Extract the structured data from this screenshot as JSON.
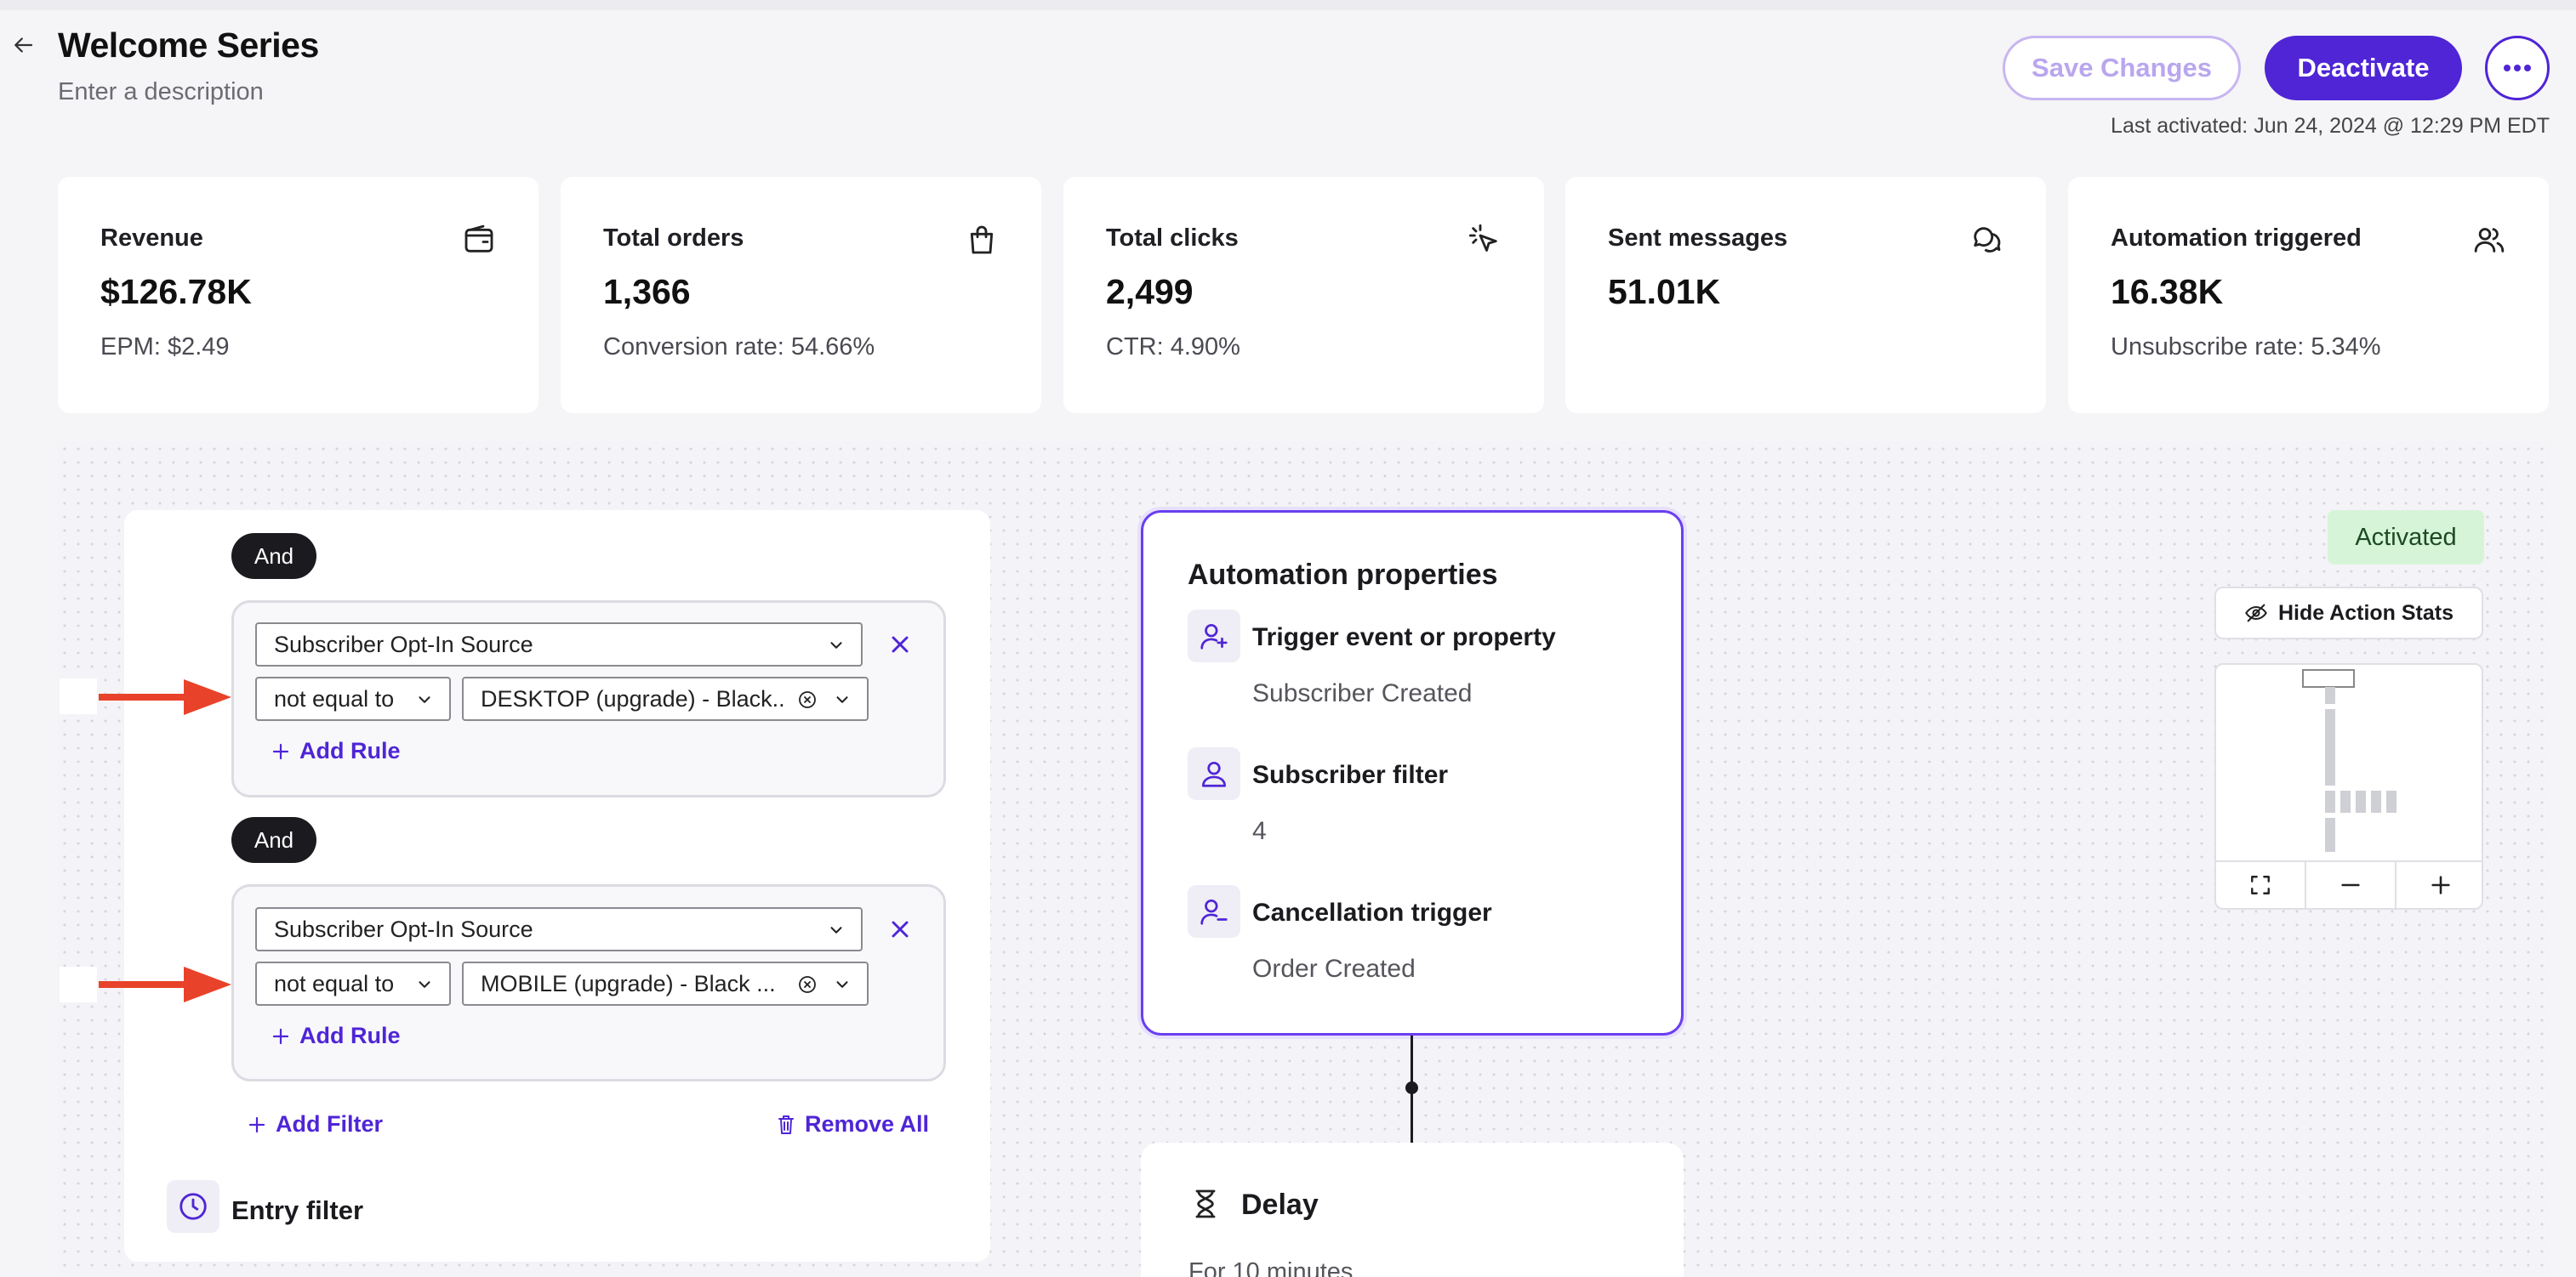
{
  "header": {
    "title": "Welcome Series",
    "description_placeholder": "Enter a description",
    "save_label": "Save Changes",
    "deactivate_label": "Deactivate",
    "last_activated": "Last activated: Jun 24, 2024 @ 12:29 PM EDT"
  },
  "stats": [
    {
      "label": "Revenue",
      "value": "$126.78K",
      "sub": "EPM: $2.49",
      "icon": "wallet-icon"
    },
    {
      "label": "Total orders",
      "value": "1,366",
      "sub": "Conversion rate: 54.66%",
      "icon": "shopping-bag-icon"
    },
    {
      "label": "Total clicks",
      "value": "2,499",
      "sub": "CTR: 4.90%",
      "icon": "cursor-click-icon"
    },
    {
      "label": "Sent messages",
      "value": "51.01K",
      "sub": "",
      "icon": "chat-bubbles-icon"
    },
    {
      "label": "Automation triggered",
      "value": "16.38K",
      "sub": "Unsubscribe rate: 5.34%",
      "icon": "users-icon"
    }
  ],
  "filters": {
    "and_label": "And",
    "groups": [
      {
        "property": "Subscriber Opt-In Source",
        "operator": "not equal to",
        "value": "DESKTOP (upgrade) - Black...",
        "add_rule": "Add Rule"
      },
      {
        "property": "Subscriber Opt-In Source",
        "operator": "not equal to",
        "value": "MOBILE (upgrade) - Black ...",
        "add_rule": "Add Rule"
      }
    ],
    "add_filter": "Add Filter",
    "remove_all": "Remove All",
    "entry_filter": "Entry filter"
  },
  "automation": {
    "title": "Automation properties",
    "properties": [
      {
        "label": "Trigger event or property",
        "value": "Subscriber Created",
        "icon": "user-plus-icon"
      },
      {
        "label": "Subscriber filter",
        "value": "4",
        "icon": "user-icon"
      },
      {
        "label": "Cancellation trigger",
        "value": "Order Created",
        "icon": "user-minus-icon"
      }
    ]
  },
  "delay": {
    "title": "Delay",
    "sub": "For 10 minutes"
  },
  "canvas_controls": {
    "status": "Activated",
    "hide_stats": "Hide Action Stats"
  },
  "colors": {
    "accent": "#4f25d6",
    "arrow": "#e8432a",
    "activated_bg": "#d6f5d8"
  }
}
